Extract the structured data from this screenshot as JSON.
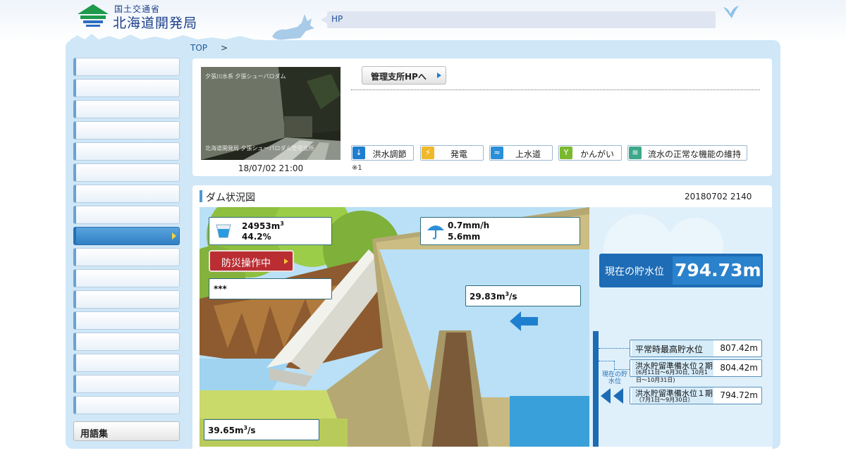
{
  "header": {
    "org_sub": "国土交通省",
    "org_main": "北海道開発局",
    "hp_label": "HP"
  },
  "breadcrumb": {
    "top": "TOP",
    "sep": ">"
  },
  "sidebar": {
    "glossary_label": "用語集"
  },
  "camera": {
    "overlay_top": "夕張川水系 夕張シューパロダム",
    "overlay_bottom": "北海道開発局 夕張シューパロダム管理支所",
    "timestamp": "18/07/02 21:00"
  },
  "office_button": "管理支所HPへ",
  "purposes": [
    {
      "label": "洪水調節",
      "icon": "flood-control-icon",
      "color": "#1e7fd0"
    },
    {
      "label": "発電",
      "icon": "power-icon",
      "color": "#f0b92a"
    },
    {
      "label": "上水道",
      "icon": "water-supply-icon",
      "color": "#2a8fd8"
    },
    {
      "label": "かんがい",
      "icon": "irrigation-icon",
      "color": "#7ab92e"
    },
    {
      "label": "流水の正常な機能の維持",
      "icon": "river-flow-icon",
      "color": "#3da88a"
    }
  ],
  "note": "※1",
  "dam": {
    "title": "ダム状況図",
    "timestamp": "20180702 2140",
    "storage_volume": "24953m",
    "storage_unit_sup": "3",
    "storage_rate": "44.2%",
    "rain_hourly": "0.7mm/h",
    "rain_total": "5.6mm",
    "operation_button": "防災操作中",
    "status_text": "***",
    "inflow": "29.83m",
    "inflow_unit": "/s",
    "outflow": "39.65m",
    "outflow_unit": "/s",
    "current_level_label": "現在の貯水位",
    "current_level_value": "794.73m",
    "current_marker_label": "現在の貯水位",
    "levels": [
      {
        "name": "平常時最高貯水位",
        "value": "807.42m"
      },
      {
        "name": "洪水貯留準備水位２期",
        "sub": "(6月11日〜6月30日, 10月1日〜10月31日)",
        "value": "804.42m"
      },
      {
        "name": "洪水貯留準備水位１期",
        "sub": "（7月1日〜9月30日）",
        "value": "794.72m"
      }
    ]
  }
}
